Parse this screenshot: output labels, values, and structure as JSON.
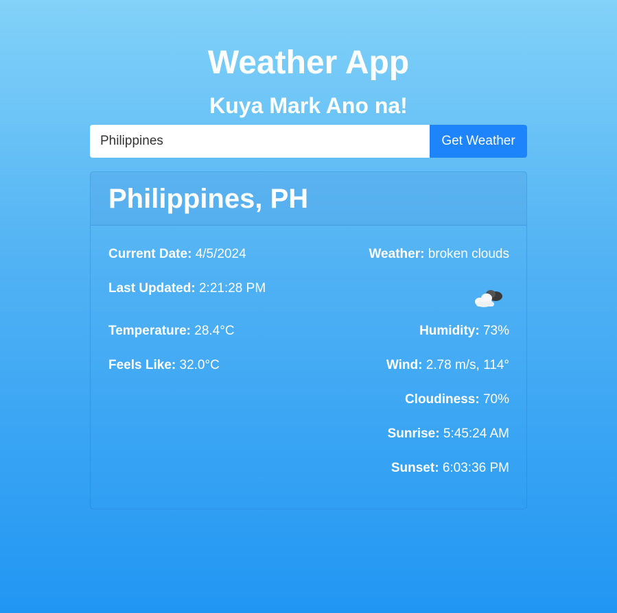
{
  "header": {
    "title": "Weather App",
    "subtitle": "Kuya Mark Ano na!"
  },
  "search": {
    "value": "Philippines",
    "button_label": "Get Weather"
  },
  "card": {
    "location": "Philippines, PH",
    "current_date_label": "Current Date:",
    "current_date": "4/5/2024",
    "last_updated_label": "Last Updated:",
    "last_updated": "2:21:28 PM",
    "temperature_label": "Temperature:",
    "temperature": "28.4°C",
    "feels_like_label": "Feels Like:",
    "feels_like": "32.0°C",
    "weather_label": "Weather:",
    "weather": "broken clouds",
    "weather_icon": "broken-clouds-icon",
    "humidity_label": "Humidity:",
    "humidity": "73%",
    "wind_label": "Wind:",
    "wind": "2.78 m/s, 114°",
    "cloudiness_label": "Cloudiness:",
    "cloudiness": "70%",
    "sunrise_label": "Sunrise:",
    "sunrise": "5:45:24 AM",
    "sunset_label": "Sunset:",
    "sunset": "6:03:36 PM"
  },
  "colors": {
    "button": "#1e84fb",
    "background_top": "#82d2f9",
    "background_bottom": "#2196f3"
  }
}
